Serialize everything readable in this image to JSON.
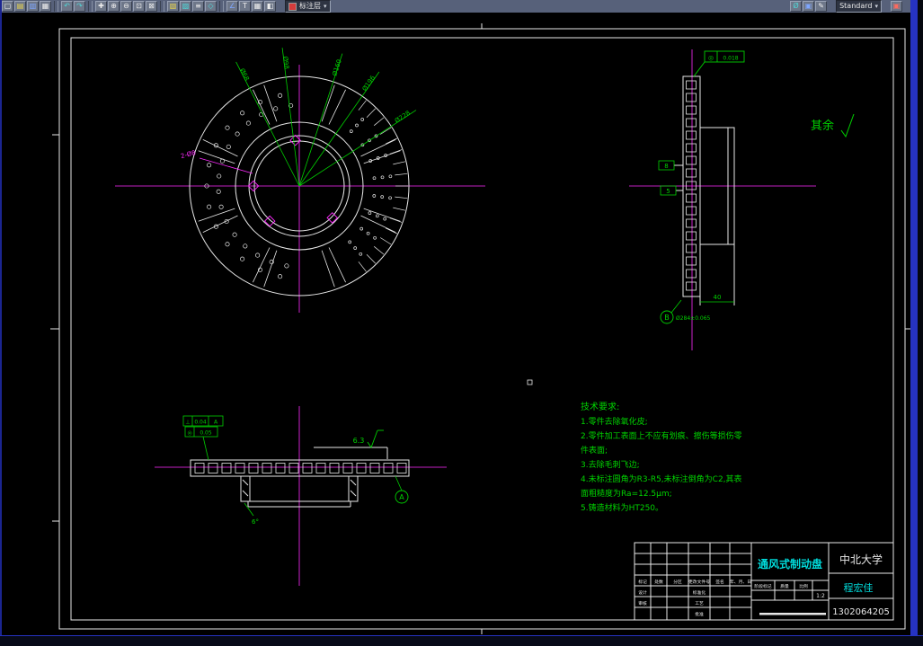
{
  "toolbar": {
    "layer_combo": "标注层",
    "style_combo": "Standard",
    "icons": [
      {
        "name": "new-file",
        "glyph": "▢"
      },
      {
        "name": "open-folder",
        "glyph": "▤"
      },
      {
        "name": "save",
        "glyph": "▥"
      },
      {
        "name": "print",
        "glyph": "▦"
      },
      {
        "name": "undo",
        "glyph": "↶"
      },
      {
        "name": "redo",
        "glyph": "↷"
      },
      {
        "name": "pan",
        "glyph": "✚"
      },
      {
        "name": "zoom-in",
        "glyph": "⊕"
      },
      {
        "name": "zoom-out",
        "glyph": "⊖"
      },
      {
        "name": "zoom-window",
        "glyph": "⊡"
      },
      {
        "name": "zoom-extents",
        "glyph": "⊠"
      },
      {
        "name": "layer-manager",
        "glyph": "▧"
      },
      {
        "name": "layer-states",
        "glyph": "▨"
      },
      {
        "name": "linetype",
        "glyph": "≡"
      },
      {
        "name": "object-snap",
        "glyph": "◇"
      },
      {
        "name": "dim-style",
        "glyph": "∠"
      },
      {
        "name": "text-style",
        "glyph": "T"
      },
      {
        "name": "table",
        "glyph": "▦"
      },
      {
        "name": "block",
        "glyph": "◧"
      },
      {
        "name": "measure",
        "glyph": "Ø"
      },
      {
        "name": "draw-order",
        "glyph": "▣"
      },
      {
        "name": "edit",
        "glyph": "✎"
      },
      {
        "name": "plot-preview",
        "glyph": "▣"
      }
    ]
  },
  "front_view": {
    "dims": [
      "Ø68",
      "Ø98",
      "Ø160",
      "Ø196",
      "Ø228"
    ],
    "leader_label": "2-Ø8"
  },
  "side_view": {
    "tol_symbol": "◎",
    "tol_value": "0.018",
    "dim_small_1": "8",
    "dim_small_2": "5",
    "dim_width": "40",
    "dim_diameter": "Ø284±0.065",
    "datum_label": "B"
  },
  "bottom_view": {
    "roughness": "6.3",
    "fcf1_symbol": "⊥",
    "fcf1_value": "0.04",
    "fcf1_datum": "A",
    "fcf2_symbol": "◎",
    "fcf2_value": "0.05",
    "angle_label": "6°",
    "datum_label": "A"
  },
  "notes": {
    "surface_default": "其余"
  },
  "tech_requirements": {
    "lines": [
      "技术要求:",
      "1.零件去除氧化皮;",
      "2.零件加工表面上不应有划痕、擦伤等损伤零",
      "件表面;",
      "3.去除毛刺飞边;",
      "4.未标注圆角为R3-R5,未标注倒角为C2,其表",
      "面粗糙度为Ra=12.5μm;",
      "5.铸造材料为HT250。"
    ]
  },
  "title_block": {
    "part_name": "通风式制动盘",
    "university": "中北大学",
    "author": "程宏佳",
    "student_id": "1302064205",
    "scale": "1:2",
    "header_cells": [
      "标记",
      "处数",
      "分区",
      "更改文件号",
      "签名",
      "年、月、日"
    ],
    "row2": [
      "设计",
      "标准化"
    ],
    "row3": [
      "审核",
      "工艺"
    ],
    "row4": [
      "批准"
    ],
    "stage_cells": [
      "阶段标记",
      "质量",
      "比例"
    ]
  },
  "colors": {
    "green": "#00d000",
    "magenta": "#ff2bff",
    "cyan": "#00dcdc",
    "frame": "#e8e8e8"
  }
}
